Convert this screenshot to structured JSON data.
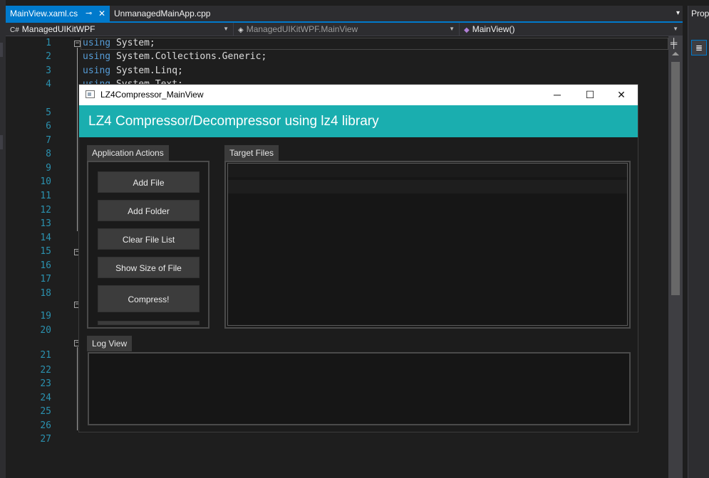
{
  "ide": {
    "tabs": [
      {
        "label": "MainView.xaml.cs",
        "active": true,
        "pin": "⊸",
        "close": "✕"
      },
      {
        "label": "UnmanagedMainApp.cpp",
        "active": false
      }
    ],
    "tab_overflow_icon": "▾",
    "nav": {
      "project": "ManagedUIKitWPF",
      "project_icon": "C#",
      "type": "ManagedUIKitWPF.MainView",
      "member": "MainView()"
    },
    "properties_title": "Prop",
    "properties_icon": "≣",
    "split_icon": "╪"
  },
  "editor": {
    "line_numbers": [
      "1",
      "2",
      "3",
      "4",
      "5",
      "6",
      "7",
      "8",
      "9",
      "10",
      "11",
      "12",
      "13",
      "14",
      "15",
      "16",
      "17",
      "18",
      "19",
      "20",
      "21",
      "22",
      "23",
      "24",
      "25",
      "26",
      "27"
    ],
    "visible_code": [
      {
        "kw": "using",
        "rest": " System;"
      },
      {
        "kw": "using",
        "rest": " System.Collections.Generic;"
      },
      {
        "kw": "using",
        "rest": " System.Linq;"
      },
      {
        "kw": "using",
        "rest": " System.Text;"
      }
    ],
    "fold_marker": "−"
  },
  "app_window": {
    "title": "LZ4Compressor_MainView",
    "minimize": "─",
    "maximize": "☐",
    "close": "✕",
    "header": "LZ4 Compressor/Decompressor using lz4 library",
    "groups": {
      "actions_label": "Application Actions",
      "targets_label": "Target Files",
      "log_label": "Log View"
    },
    "buttons": {
      "add_file": "Add File",
      "add_folder": "Add Folder",
      "clear_list": "Clear File List",
      "show_size": "Show Size of File",
      "compress": "Compress!"
    },
    "colors": {
      "header_bg": "#1aaeaf",
      "accent": "#007acc"
    }
  }
}
